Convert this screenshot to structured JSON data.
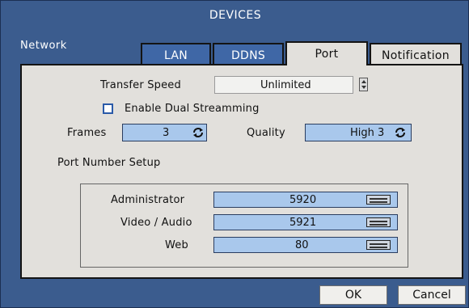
{
  "window": {
    "title": "DEVICES"
  },
  "section": {
    "label": "Network"
  },
  "tabs": [
    {
      "label": "LAN"
    },
    {
      "label": "DDNS"
    },
    {
      "label": "Port"
    },
    {
      "label": "Notification"
    }
  ],
  "transfer_speed": {
    "label": "Transfer Speed",
    "value": "Unlimited"
  },
  "dual_stream": {
    "label": "Enable Dual Streamming",
    "checked": false
  },
  "frames": {
    "label": "Frames",
    "value": "3"
  },
  "quality": {
    "label": "Quality",
    "value": "High 3"
  },
  "port_setup": {
    "title": "Port Number Setup",
    "rows": [
      {
        "label": "Administrator",
        "value": "5920"
      },
      {
        "label": "Video / Audio",
        "value": "5921"
      },
      {
        "label": "Web",
        "value": "80"
      }
    ]
  },
  "buttons": {
    "ok": "OK",
    "cancel": "Cancel"
  }
}
